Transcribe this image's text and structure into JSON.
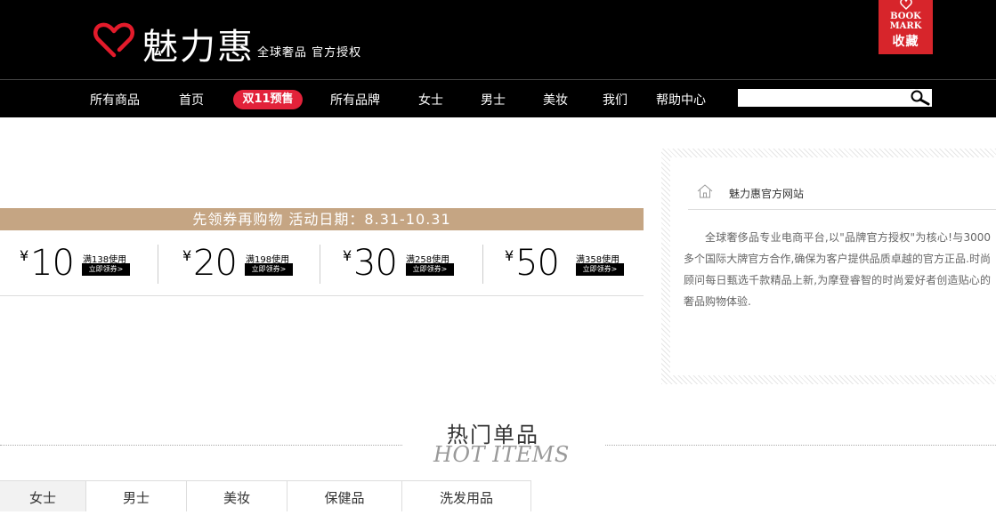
{
  "header": {
    "brand_name": "魅力惠",
    "tagline": "全球奢品 官方授权",
    "bookmark": {
      "en_text": "BOOK\nMARK",
      "cn_text": "收藏",
      "color": "#d7252b"
    }
  },
  "nav": {
    "items": [
      "所有商品",
      "首页",
      "所有品牌",
      "女士",
      "男士",
      "美妆",
      "我们",
      "帮助中心"
    ],
    "presale_label": "双11预售",
    "search_placeholder": ""
  },
  "coupon_section": {
    "banner_text": "先领券再购物  活动日期：8.31-10.31",
    "banner_color": "#c5a583",
    "coupons": [
      {
        "currency": "¥",
        "amount": "10",
        "condition": "满138使用",
        "button": "立即领券>"
      },
      {
        "currency": "¥",
        "amount": "20",
        "condition": "满198使用",
        "button": "立即领券>"
      },
      {
        "currency": "¥",
        "amount": "30",
        "condition": "满258使用",
        "button": "立即领券>"
      },
      {
        "currency": "¥",
        "amount": "50",
        "condition": "满358使用",
        "button": "立即领券>"
      }
    ]
  },
  "side_box": {
    "title": "魅力惠官方网站",
    "description": "全球奢侈品专业电商平台,以\"品牌官方授权\"为核心!与3000多个国际大牌官方合作,确保为客户提供品质卓越的官方正品.时尚顾问每日甄选千款精品上新,为摩登睿智的时尚爱好者创造贴心的奢品购物体验."
  },
  "hot_items": {
    "title_cn": "热门单品",
    "title_en": "HOT ITEMS",
    "tabs": [
      "女士",
      "男士",
      "美妆",
      "保健品",
      "洗发用品"
    ],
    "active_tab": 0
  }
}
